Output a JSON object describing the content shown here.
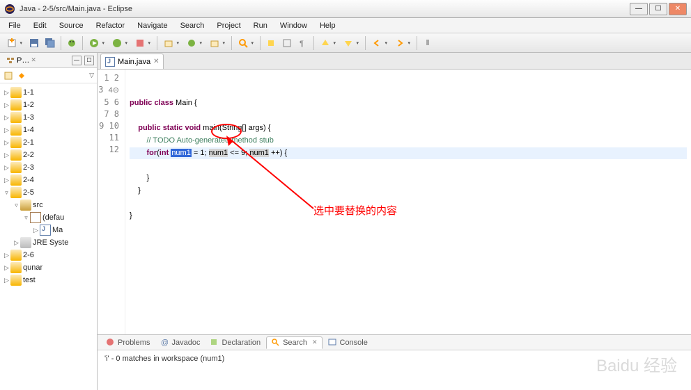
{
  "title": "Java - 2-5/src/Main.java - Eclipse",
  "menu": [
    "File",
    "Edit",
    "Source",
    "Refactor",
    "Navigate",
    "Search",
    "Project",
    "Run",
    "Window",
    "Help"
  ],
  "sidebar": {
    "tab": "P…",
    "items": [
      {
        "label": "1-1",
        "depth": 0,
        "exp": "▷",
        "icon": "folder-ico"
      },
      {
        "label": "1-2",
        "depth": 0,
        "exp": "▷",
        "icon": "folder-ico"
      },
      {
        "label": "1-3",
        "depth": 0,
        "exp": "▷",
        "icon": "folder-ico"
      },
      {
        "label": "1-4",
        "depth": 0,
        "exp": "▷",
        "icon": "folder-ico"
      },
      {
        "label": "2-1",
        "depth": 0,
        "exp": "▷",
        "icon": "folder-ico"
      },
      {
        "label": "2-2",
        "depth": 0,
        "exp": "▷",
        "icon": "folder-ico"
      },
      {
        "label": "2-3",
        "depth": 0,
        "exp": "▷",
        "icon": "folder-ico"
      },
      {
        "label": "2-4",
        "depth": 0,
        "exp": "▷",
        "icon": "folder-ico"
      },
      {
        "label": "2-5",
        "depth": 0,
        "exp": "▿",
        "icon": "folder-ico"
      },
      {
        "label": "src",
        "depth": 1,
        "exp": "▿",
        "icon": "src-ico"
      },
      {
        "label": "(defau",
        "depth": 2,
        "exp": "▿",
        "icon": "pkg-ico"
      },
      {
        "label": "Ma",
        "depth": 3,
        "exp": "▷",
        "icon": "java-ico"
      },
      {
        "label": "JRE Syste",
        "depth": 1,
        "exp": "▷",
        "icon": "jre-ico"
      },
      {
        "label": "2-6",
        "depth": 0,
        "exp": "▷",
        "icon": "folder-ico"
      },
      {
        "label": "qunar",
        "depth": 0,
        "exp": "▷",
        "icon": "folder-ico"
      },
      {
        "label": "test",
        "depth": 0,
        "exp": "▷",
        "icon": "folder-ico"
      }
    ]
  },
  "editor": {
    "tab": "Main.java",
    "lines": [
      1,
      2,
      3,
      4,
      5,
      6,
      7,
      8,
      9,
      10,
      11,
      12
    ],
    "code": {
      "l2_a": "public",
      "l2_b": "class",
      "l2_c": " Main {",
      "l4_a": "public",
      "l4_b": "static",
      "l4_c": "void",
      "l4_d": " main(String[] args) {",
      "l5": "// TODO Auto-generated method stub",
      "l6_a": "for",
      "l6_b": "(",
      "l6_c": "int",
      "l6_sel": "num1",
      "l6_d": " = 1; ",
      "l6_hl1": "num1",
      "l6_e": " <= 9; ",
      "l6_hl2": "num1",
      "l6_f": " ++) {",
      "l8": "}",
      "l9": "}",
      "l11": "}"
    },
    "annotation": "选中要替换的内容"
  },
  "bottom": {
    "tabs": [
      "Problems",
      "Javadoc",
      "Declaration",
      "Search",
      "Console"
    ],
    "active": 3,
    "content": "'i' - 0 matches in workspace (num1)"
  },
  "watermark": "Baidu 经验"
}
